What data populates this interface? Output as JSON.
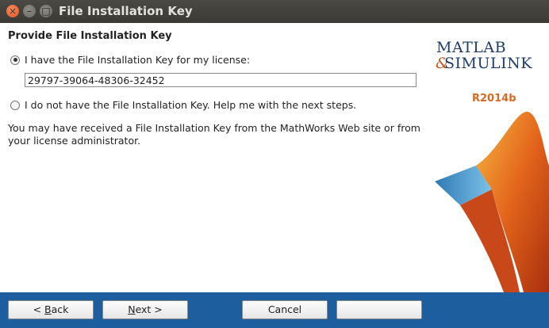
{
  "window": {
    "title": "File Installation Key",
    "close_glyph": "×",
    "minimize_glyph": "–",
    "maximize_glyph": "□"
  },
  "main": {
    "heading": "Provide File Installation Key",
    "option_have_key": "I have the File Installation Key for my license:",
    "key_value": "29797-39064-48306-32452",
    "option_no_key": "I do not have the File Installation Key.  Help me with the next steps.",
    "note_line1": "You may have received a File Installation Key from the MathWorks Web site or from",
    "note_line2": "your license administrator."
  },
  "branding": {
    "line1": "MATLAB",
    "amp": "&",
    "line2": "SIMULINK",
    "release": "R2014b"
  },
  "buttons": {
    "back_prefix": "< ",
    "back_mnemonic": "B",
    "back_rest": "ack",
    "next_mnemonic": "N",
    "next_rest": "ext >",
    "cancel": "Cancel"
  },
  "colors": {
    "titlebar": "#3b3a36",
    "bottombar": "#1d5f9e",
    "brand": "#1e3c6a",
    "accent": "#d96b20"
  }
}
